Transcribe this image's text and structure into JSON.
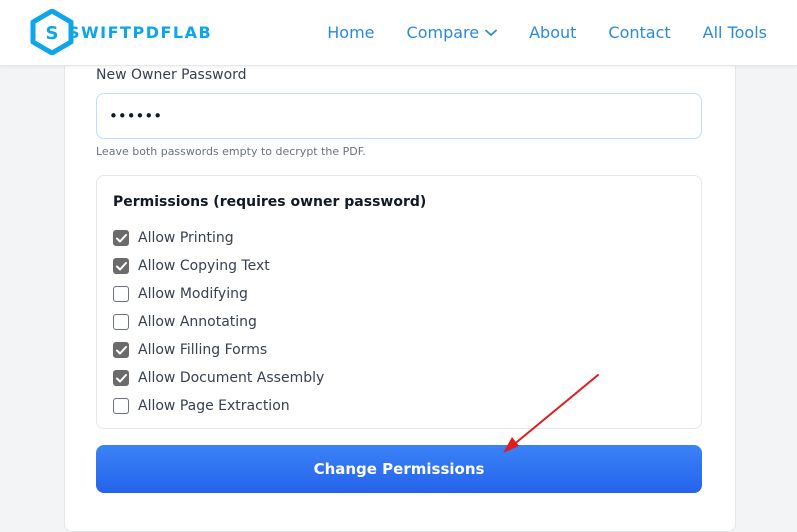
{
  "header": {
    "logo_text": "SWIFTPDFLAB",
    "nav": [
      {
        "label": "Home"
      },
      {
        "label": "Compare",
        "has_dropdown": true
      },
      {
        "label": "About"
      },
      {
        "label": "Contact"
      },
      {
        "label": "All Tools"
      }
    ]
  },
  "form": {
    "owner_password_label": "New Owner Password",
    "owner_password_value": "••••••",
    "hint": "Leave both passwords empty to decrypt the PDF.",
    "permissions_title": "Permissions (requires owner password)",
    "permissions": [
      {
        "label": "Allow Printing",
        "checked": true
      },
      {
        "label": "Allow Copying Text",
        "checked": true
      },
      {
        "label": "Allow Modifying",
        "checked": false
      },
      {
        "label": "Allow Annotating",
        "checked": false
      },
      {
        "label": "Allow Filling Forms",
        "checked": true
      },
      {
        "label": "Allow Document Assembly",
        "checked": true
      },
      {
        "label": "Allow Page Extraction",
        "checked": false
      }
    ],
    "submit_label": "Change Permissions"
  },
  "colors": {
    "brand": "#0ea5e9",
    "nav_link": "#2b8bd9",
    "button": "#2563eb",
    "annotation_arrow": "#e11d1d"
  }
}
